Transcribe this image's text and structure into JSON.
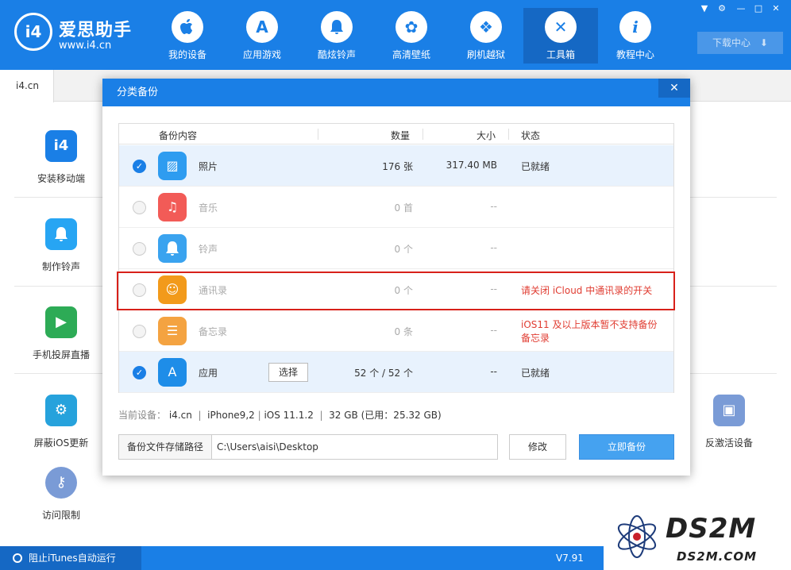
{
  "brand": {
    "logo": "i4",
    "name": "爱思助手",
    "url": "www.i4.cn"
  },
  "nav": [
    {
      "label": "我的设备",
      "icon": "apple-icon"
    },
    {
      "label": "应用游戏",
      "icon": "app-store-icon"
    },
    {
      "label": "酷炫铃声",
      "icon": "bell-icon"
    },
    {
      "label": "高清壁纸",
      "icon": "flower-icon"
    },
    {
      "label": "刷机越狱",
      "icon": "dropbox-icon"
    },
    {
      "label": "工具箱",
      "icon": "tools-icon",
      "active": true
    },
    {
      "label": "教程中心",
      "icon": "info-icon"
    }
  ],
  "window_controls": [
    "shirt-icon",
    "gear-icon",
    "minimize-icon",
    "maximize-icon",
    "close-icon"
  ],
  "download_center": "下载中心",
  "tab": "i4.cn",
  "tools_left": [
    {
      "label": "安装移动端",
      "icon": "i4-app-icon",
      "color": "#1a7fe6"
    },
    {
      "label": "制作铃声",
      "icon": "bell-plus-icon",
      "color": "#27a5f3"
    },
    {
      "label": "手机投屏直播",
      "icon": "screen-mirror-icon",
      "color": "#2dab56"
    },
    {
      "label": "屏蔽iOS更新",
      "icon": "gear-block-icon",
      "color": "#26a2dc"
    },
    {
      "label": "访问限制",
      "icon": "key-icon",
      "color": "#7a9bd6"
    }
  ],
  "tool_right": {
    "label": "反激活设备",
    "icon": "tablet-icon",
    "color": "#7a9bd6"
  },
  "bottom": {
    "itunes_label": "阻止iTunes自动运行",
    "version": "V7.91"
  },
  "watermark": {
    "big": "DS2M",
    "small": "DS2M.COM"
  },
  "dialog": {
    "title": "分类备份",
    "close": "✕",
    "columns": {
      "content": "备份内容",
      "qty": "数量",
      "size": "大小",
      "status": "状态"
    },
    "rows": [
      {
        "name": "照片",
        "qty": "176 张",
        "size": "317.40 MB",
        "status": "已就绪",
        "checked": true,
        "icon": "photo-icon",
        "color": "#2e9cf0"
      },
      {
        "name": "音乐",
        "qty": "0 首",
        "size": "--",
        "status": "",
        "checked": false,
        "icon": "music-icon",
        "color": "#f25b57"
      },
      {
        "name": "铃声",
        "qty": "0 个",
        "size": "--",
        "status": "",
        "checked": false,
        "icon": "bell-icon",
        "color": "#3aa3ef"
      },
      {
        "name": "通讯录",
        "qty": "0 个",
        "size": "--",
        "status": "请关闭 iCloud 中通讯录的开关",
        "checked": false,
        "icon": "contacts-icon",
        "color": "#f29a1b"
      },
      {
        "name": "备忘录",
        "qty": "0 条",
        "size": "--",
        "status_line1": "iOS11 及以上版本暂不支持备份",
        "status_line2": "备忘录",
        "checked": false,
        "icon": "notes-icon",
        "color": "#f4a341"
      },
      {
        "name": "应用",
        "qty": "52 个 / 52 个",
        "size": "--",
        "status": "已就绪",
        "checked": true,
        "icon": "app-store-icon",
        "color": "#1e8de8",
        "choose_label": "选择"
      }
    ],
    "device": {
      "label": "当前设备：",
      "name": "i4.cn",
      "model": "iPhone9,2",
      "ios": "iOS 11.1.2",
      "capacity": "32 GB",
      "used": "(已用：25.32 GB)"
    },
    "path_label": "备份文件存储路径",
    "path_value": "C:\\Users\\aisi\\Desktop",
    "modify_label": "修改",
    "backup_label": "立即备份"
  }
}
